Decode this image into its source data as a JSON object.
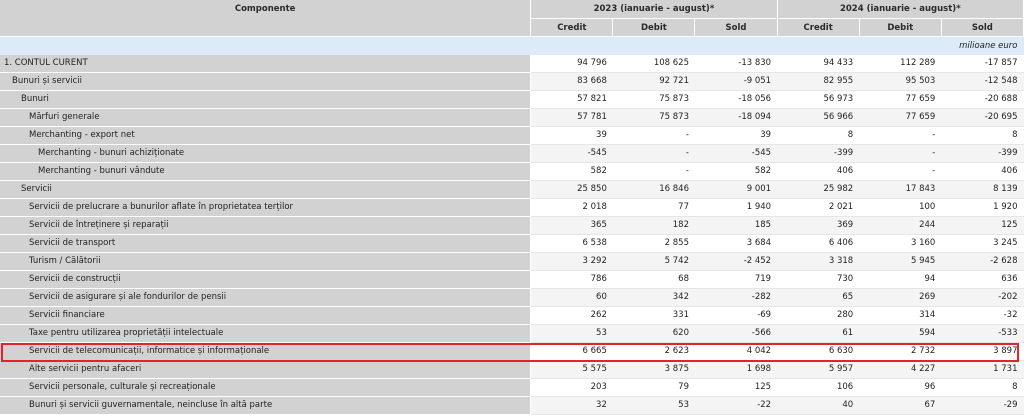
{
  "header": {
    "componente": "Componente",
    "period_2023": "2023 (ianuarie - august)*",
    "period_2024": "2024 (ianuarie - august)*",
    "credit": "Credit",
    "debit": "Debit",
    "sold": "Sold"
  },
  "unit_label": "milioane euro",
  "rows": [
    {
      "label": "1. CONTUL CURENT",
      "indent": 0,
      "v": [
        "94 796",
        "108 625",
        "-13 830",
        "94 433",
        "112 289",
        "-17 857"
      ]
    },
    {
      "label": "Bunuri și servicii",
      "indent": 1,
      "v": [
        "83 668",
        "92 721",
        "-9 051",
        "82 955",
        "95 503",
        "-12 548"
      ]
    },
    {
      "label": "Bunuri",
      "indent": 2,
      "v": [
        "57 821",
        "75 873",
        "-18 056",
        "56 973",
        "77 659",
        "-20 688"
      ]
    },
    {
      "label": "Mărfuri generale",
      "indent": 3,
      "v": [
        "57 781",
        "75 873",
        "-18 094",
        "56 966",
        "77 659",
        "-20 695"
      ]
    },
    {
      "label": "Merchanting - export net",
      "indent": 3,
      "v": [
        "39",
        "-",
        "39",
        "8",
        "-",
        "8"
      ]
    },
    {
      "label": "Merchanting - bunuri achiziționate",
      "indent": 4,
      "v": [
        "-545",
        "-",
        "-545",
        "-399",
        "-",
        "-399"
      ]
    },
    {
      "label": "Merchanting - bunuri vândute",
      "indent": 4,
      "v": [
        "582",
        "-",
        "582",
        "406",
        "-",
        "406"
      ]
    },
    {
      "label": "Servicii",
      "indent": 2,
      "v": [
        "25 850",
        "16 846",
        "9 001",
        "25 982",
        "17 843",
        "8 139"
      ]
    },
    {
      "label": "Servicii de prelucrare a bunurilor aflate în proprietatea terților",
      "indent": 3,
      "v": [
        "2 018",
        "77",
        "1 940",
        "2 021",
        "100",
        "1 920"
      ]
    },
    {
      "label": "Servicii de întreținere și reparații",
      "indent": 3,
      "v": [
        "365",
        "182",
        "185",
        "369",
        "244",
        "125"
      ]
    },
    {
      "label": "Servicii de transport",
      "indent": 3,
      "v": [
        "6 538",
        "2 855",
        "3 684",
        "6 406",
        "3 160",
        "3 245"
      ]
    },
    {
      "label": "Turism / Călătorii",
      "indent": 3,
      "v": [
        "3 292",
        "5 742",
        "-2 452",
        "3 318",
        "5 945",
        "-2 628"
      ]
    },
    {
      "label": "Servicii de construcții",
      "indent": 3,
      "v": [
        "786",
        "68",
        "719",
        "730",
        "94",
        "636"
      ]
    },
    {
      "label": "Servicii de asigurare și ale fondurilor de pensii",
      "indent": 3,
      "v": [
        "60",
        "342",
        "-282",
        "65",
        "269",
        "-202"
      ]
    },
    {
      "label": "Servicii financiare",
      "indent": 3,
      "v": [
        "262",
        "331",
        "-69",
        "280",
        "314",
        "-32"
      ]
    },
    {
      "label": "Taxe pentru utilizarea proprietății intelectuale",
      "indent": 3,
      "v": [
        "53",
        "620",
        "-566",
        "61",
        "594",
        "-533"
      ]
    },
    {
      "label": "Servicii de telecomunicații, informatice și informaționale",
      "indent": 3,
      "v": [
        "6 665",
        "2 623",
        "4 042",
        "6 630",
        "2 732",
        "3 897"
      ]
    },
    {
      "label": "Alte servicii pentru afaceri",
      "indent": 3,
      "v": [
        "5 575",
        "3 875",
        "1 698",
        "5 957",
        "4 227",
        "1 731"
      ]
    },
    {
      "label": "Servicii personale, culturale și recreaționale",
      "indent": 3,
      "v": [
        "203",
        "79",
        "125",
        "106",
        "96",
        "8"
      ]
    },
    {
      "label": "Bunuri și servicii guvernamentale, neincluse în altă parte",
      "indent": 3,
      "v": [
        "32",
        "53",
        "-22",
        "40",
        "67",
        "-29"
      ]
    }
  ]
}
